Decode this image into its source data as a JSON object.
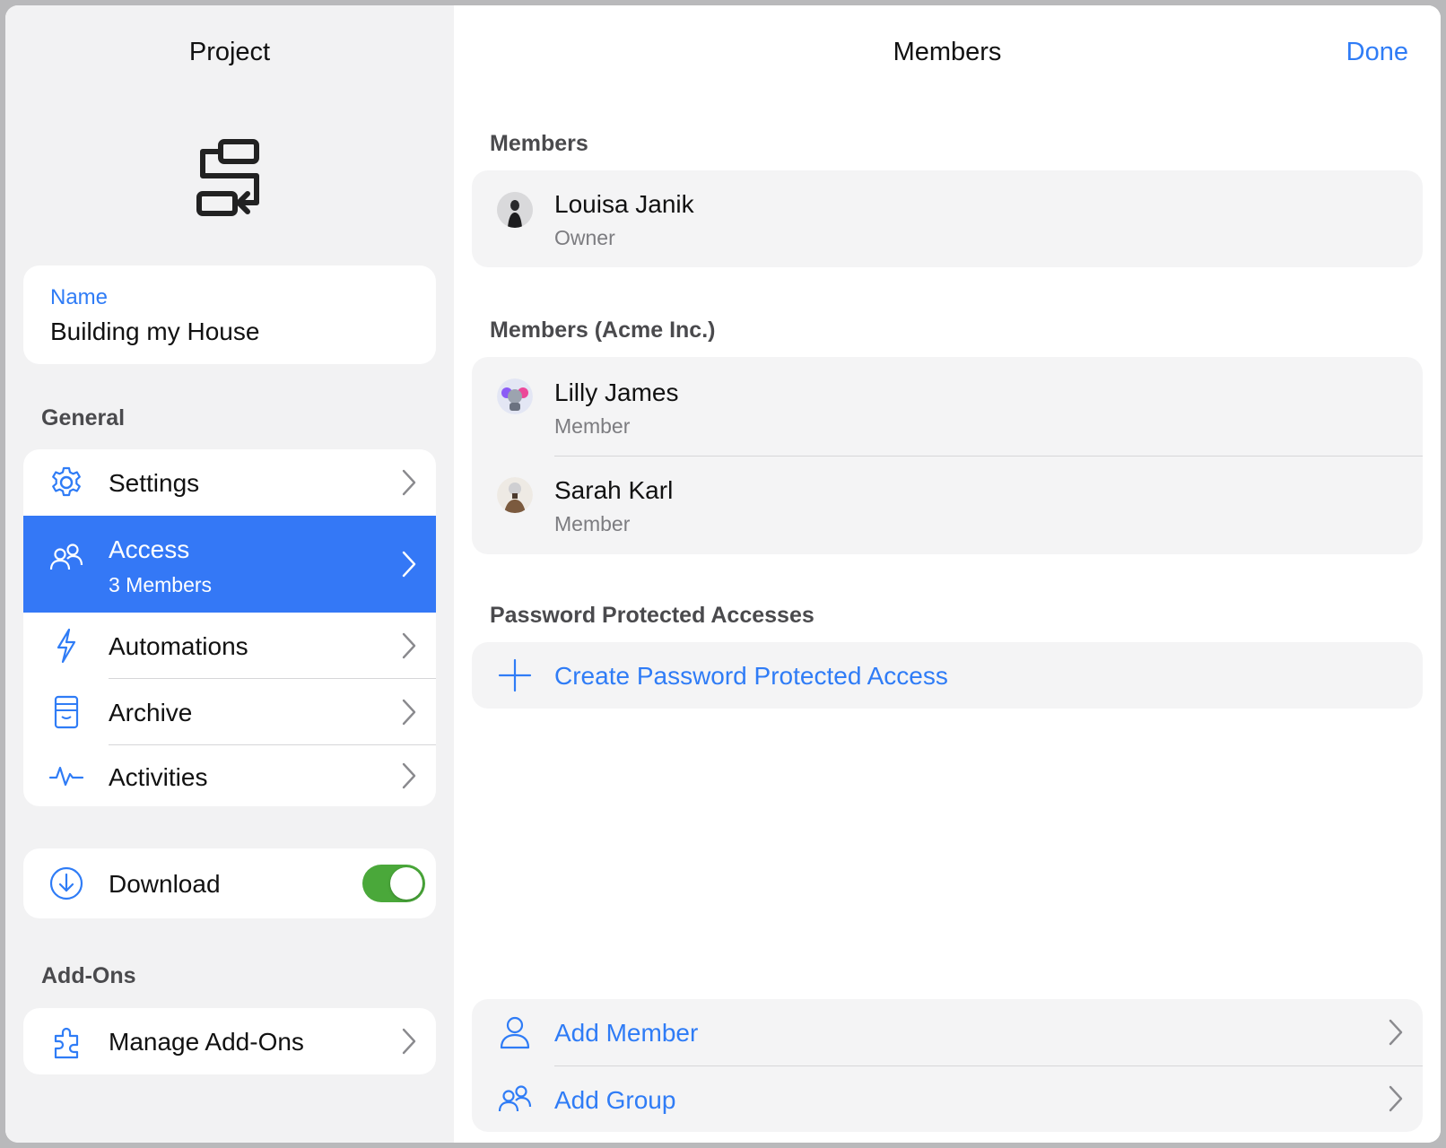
{
  "left_panel": {
    "title": "Project",
    "name_card": {
      "label": "Name",
      "value": "Building my House"
    },
    "general_header": "General",
    "general_items": [
      {
        "label": "Settings",
        "icon": "gear-icon"
      },
      {
        "label": "Access",
        "subtitle": "3 Members",
        "icon": "people-icon",
        "selected": true
      },
      {
        "label": "Automations",
        "icon": "bolt-icon"
      },
      {
        "label": "Archive",
        "icon": "archive-box-icon"
      },
      {
        "label": "Activities",
        "icon": "activity-pulse-icon"
      }
    ],
    "download": {
      "label": "Download",
      "icon": "download-circle-icon",
      "enabled": true
    },
    "addons_header": "Add-Ons",
    "addons_items": [
      {
        "label": "Manage Add-Ons",
        "icon": "puzzle-piece-icon"
      }
    ]
  },
  "right_panel": {
    "title": "Members",
    "done_label": "Done",
    "members_header": "Members",
    "members": [
      {
        "name": "Louisa Janik",
        "role": "Owner"
      }
    ],
    "org_header": "Members (Acme Inc.)",
    "org_members": [
      {
        "name": "Lilly James",
        "role": "Member"
      },
      {
        "name": "Sarah Karl",
        "role": "Member"
      }
    ],
    "password_header": "Password Protected Accesses",
    "create_password_label": "Create Password Protected Access",
    "actions": [
      {
        "label": "Add Member",
        "icon": "person-icon"
      },
      {
        "label": "Add Group",
        "icon": "group-icon"
      }
    ]
  },
  "colors": {
    "accent": "#2f7cf6",
    "selected_row": "#3478f6",
    "toggle_on": "#4aa83a",
    "sidebar_bg": "#f2f2f3"
  }
}
